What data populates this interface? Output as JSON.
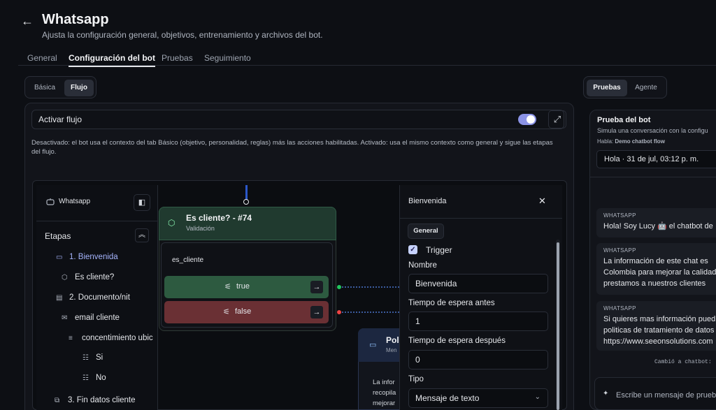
{
  "header": {
    "back_icon": "arrow-left-icon",
    "title": "Whatsapp",
    "subtitle": "Ajusta la configuración general, objetivos, entrenamiento y archivos del bot."
  },
  "tabs": [
    {
      "label": "General"
    },
    {
      "label": "Configuración del bot",
      "active": true
    },
    {
      "label": "Pruebas"
    },
    {
      "label": "Seguimiento"
    }
  ],
  "mode_switch": {
    "options": [
      "Básica",
      "Flujo"
    ],
    "selected": "Flujo"
  },
  "flow_toggle": {
    "label": "Activar flujo",
    "enabled": true
  },
  "description": "Desactivado: el bot usa el contexto del tab Básico (objetivo, personalidad, reglas) más las acciones habilitadas. Activado: usa el mismo contexto como general y sigue las etapas del flujo.",
  "sidebar": {
    "name": "Whatsapp",
    "section_title": "Etapas",
    "stages": [
      {
        "label": "1. Bienvenida",
        "icon": "message-icon",
        "selected": true
      },
      {
        "label": "Es cliente?",
        "icon": "shield-icon"
      },
      {
        "label": "2. Documento/nit",
        "icon": "document-icon"
      },
      {
        "label": "email cliente",
        "icon": "mail-icon"
      },
      {
        "label": "concentimiento ubic",
        "icon": "list-icon"
      },
      {
        "label": "Si",
        "icon": "options-icon"
      },
      {
        "label": "No",
        "icon": "options-icon"
      },
      {
        "label": "3. Fin datos cliente",
        "icon": "stack-icon"
      }
    ]
  },
  "node": {
    "title": "Es cliente? - #74",
    "subtitle": "Validación",
    "variable": "es_cliente",
    "branches": [
      {
        "label": "true",
        "color": "#2d5a40"
      },
      {
        "label": "false",
        "color": "#6a3034"
      }
    ]
  },
  "node2": {
    "title": "Pol",
    "subtitle": "Men",
    "lines": [
      "La infor",
      "recopila",
      "mejorar"
    ]
  },
  "details": {
    "title": "Bienvenida",
    "tab": "General",
    "trigger": {
      "label": "Trigger",
      "checked": true
    },
    "fields": {
      "name": {
        "label": "Nombre",
        "value": "Bienvenida"
      },
      "wait_before": {
        "label": "Tiempo de espera antes",
        "value": "1"
      },
      "wait_after": {
        "label": "Tiempo de espera después",
        "value": "0"
      },
      "type": {
        "label": "Tipo",
        "value": "Mensaje de texto"
      }
    }
  },
  "right_switch": {
    "options": [
      "Pruebas",
      "Agente"
    ],
    "selected": "Pruebas"
  },
  "test": {
    "title": "Prueba del bot",
    "subtitle": "Simula una conversación con la configu",
    "habla_label": "Habla:",
    "habla_value": "Demo chatbot flow",
    "date": "Hola · 31 de jul, 03:12 p. m.",
    "messages": [
      {
        "sender": "WHATSAPP",
        "lines": [
          "Hola! Soy Lucy 🤖 el chatbot de"
        ]
      },
      {
        "sender": "WHATSAPP",
        "lines": [
          "La información de este chat es",
          "Colombia para mejorar la calidad",
          "prestamos a nuestros clientes"
        ]
      },
      {
        "sender": "WHATSAPP",
        "lines": [
          "Si quieres mas información pued",
          "politicas de tratamiento de datos",
          "https://www.seeonsolutions.com"
        ]
      }
    ],
    "system_note": "Cambió a chatbot:",
    "input_placeholder": "Escribe un mensaje de prueba"
  }
}
